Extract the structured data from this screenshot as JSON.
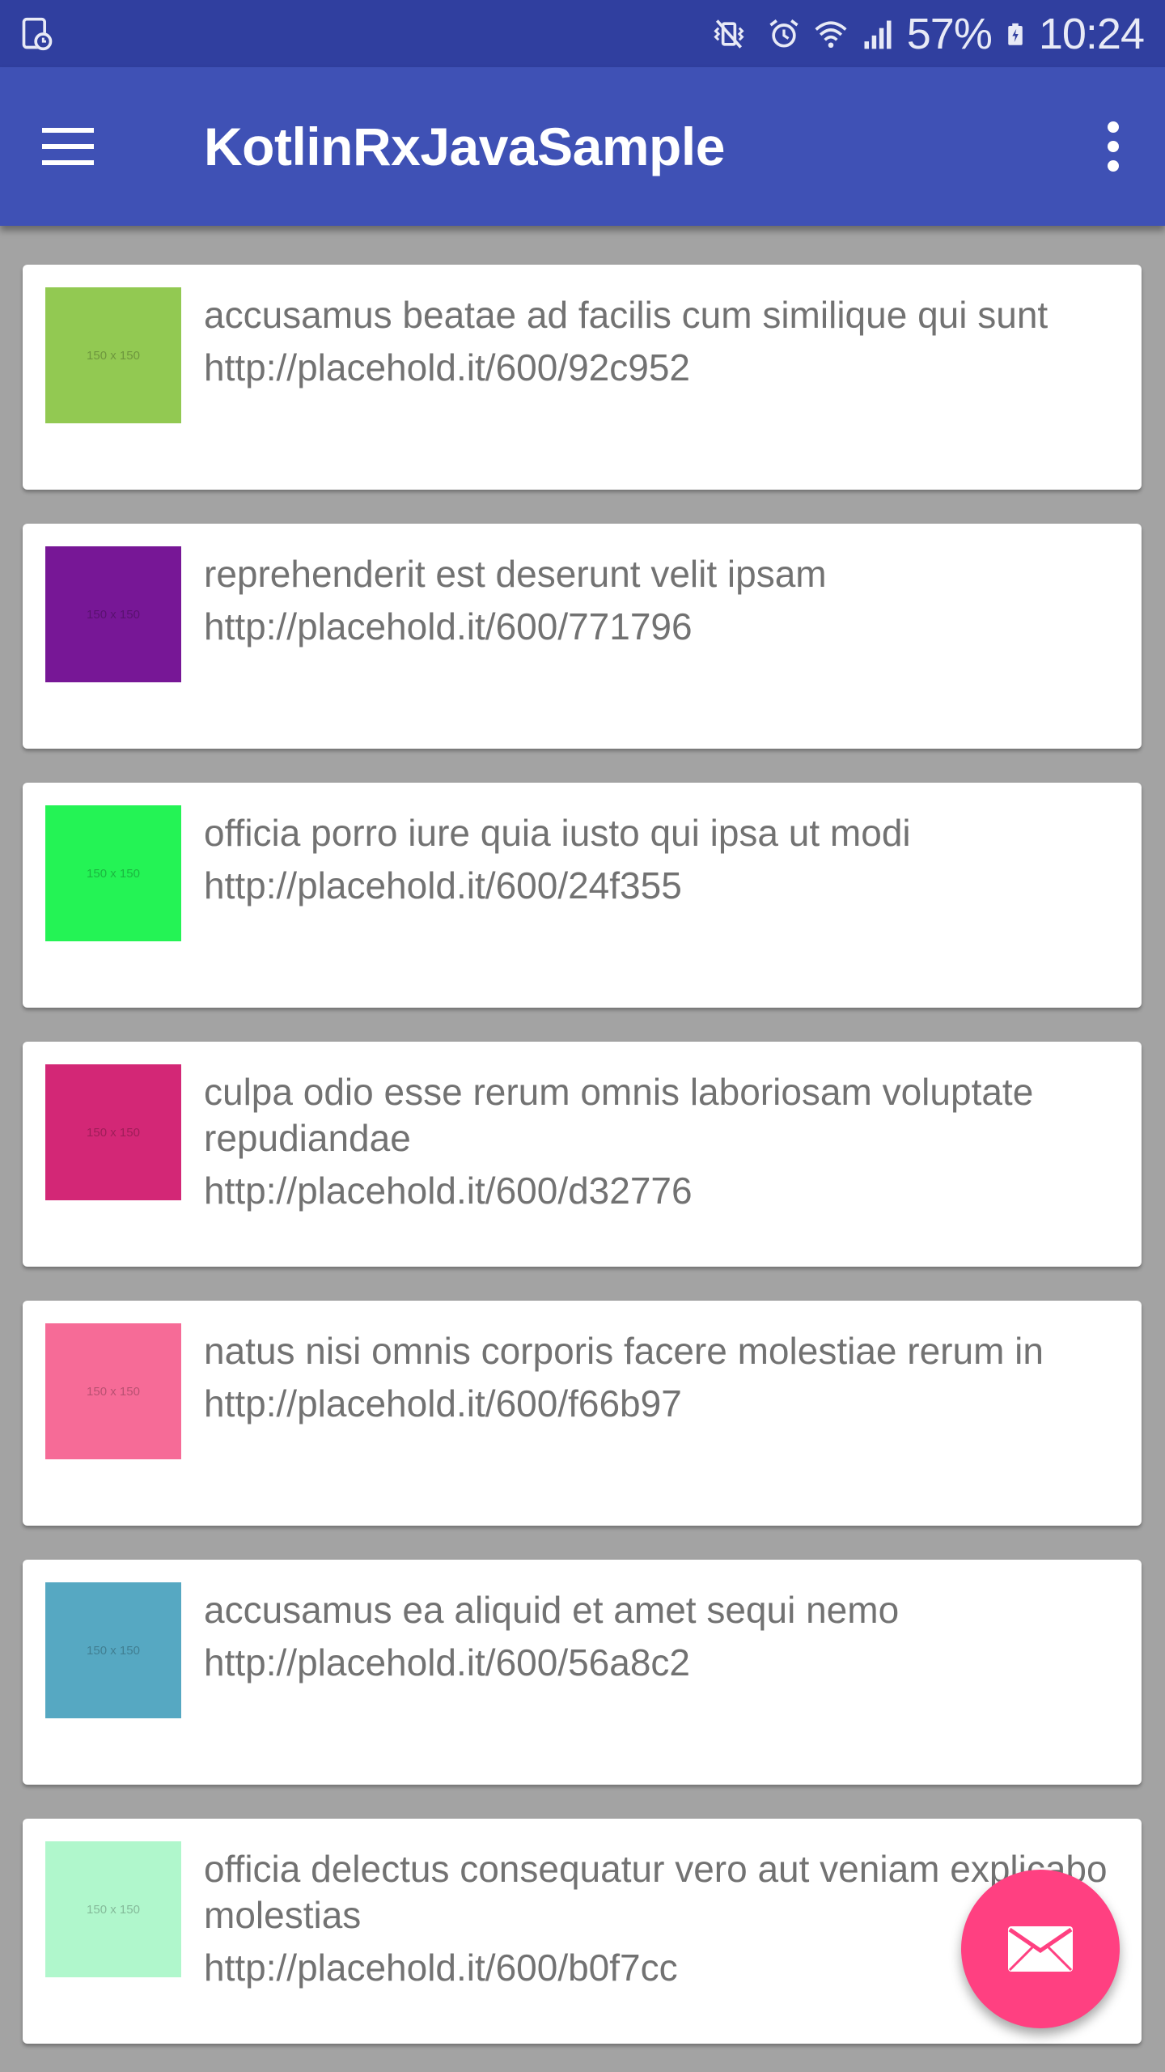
{
  "status_bar": {
    "battery": "57%",
    "time": "10:24"
  },
  "app_bar": {
    "title": "KotlinRxJavaSample"
  },
  "items": [
    {
      "title": "accusamus beatae ad facilis cum similique qui sunt",
      "url": "http://placehold.it/600/92c952",
      "color": "#92c952",
      "thumb_label": "150 x 150"
    },
    {
      "title": "reprehenderit est deserunt velit ipsam",
      "url": "http://placehold.it/600/771796",
      "color": "#771796",
      "thumb_label": "150 x 150"
    },
    {
      "title": "officia porro iure quia iusto qui ipsa ut modi",
      "url": "http://placehold.it/600/24f355",
      "color": "#24f355",
      "thumb_label": "150 x 150"
    },
    {
      "title": "culpa odio esse rerum omnis laboriosam voluptate repudiandae",
      "url": "http://placehold.it/600/d32776",
      "color": "#d32776",
      "thumb_label": "150 x 150"
    },
    {
      "title": "natus nisi omnis corporis facere molestiae rerum in",
      "url": "http://placehold.it/600/f66b97",
      "color": "#f66b97",
      "thumb_label": "150 x 150"
    },
    {
      "title": "accusamus ea aliquid et amet sequi nemo",
      "url": "http://placehold.it/600/56a8c2",
      "color": "#56a8c2",
      "thumb_label": "150 x 150"
    },
    {
      "title": "officia delectus consequatur vero aut veniam explicabo molestias",
      "url": "http://placehold.it/600/b0f7cc",
      "color": "#b0f7cc",
      "thumb_label": "150 x 150"
    }
  ],
  "fab": {
    "icon": "email-icon",
    "color": "#ff4081"
  },
  "colors": {
    "status_bar": "#303f9f",
    "app_bar": "#3f51b5",
    "background": "#a3a3a3"
  }
}
